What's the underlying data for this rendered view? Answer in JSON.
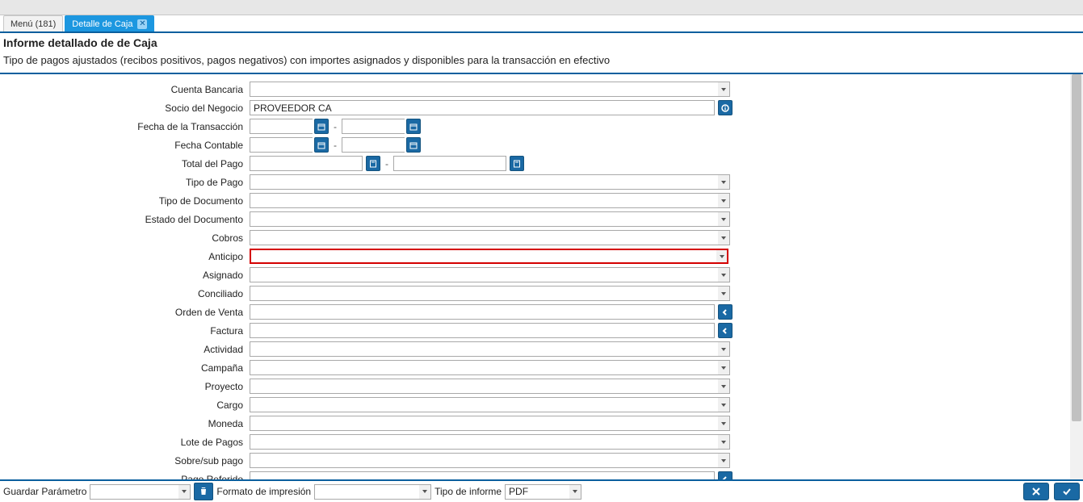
{
  "tabs": {
    "menu": "Menú (181)",
    "active": "Detalle de Caja"
  },
  "header": {
    "title": "Informe detallado de de Caja",
    "desc": "Tipo de pagos ajustados (recibos positivos, pagos negativos) con importes asignados y disponibles para la transacción en efectivo"
  },
  "labels": {
    "cuenta_bancaria": "Cuenta Bancaria",
    "socio_negocio": "Socio del Negocio",
    "fecha_transaccion": "Fecha de la Transacción",
    "fecha_contable": "Fecha Contable",
    "total_pago": "Total del Pago",
    "tipo_pago": "Tipo de Pago",
    "tipo_documento": "Tipo de Documento",
    "estado_documento": "Estado del Documento",
    "cobros": "Cobros",
    "anticipo": "Anticipo",
    "asignado": "Asignado",
    "conciliado": "Conciliado",
    "orden_venta": "Orden de Venta",
    "factura": "Factura",
    "actividad": "Actividad",
    "campana": "Campaña",
    "proyecto": "Proyecto",
    "cargo": "Cargo",
    "moneda": "Moneda",
    "lote_pagos": "Lote de Pagos",
    "sobre_sub_pago": "Sobre/sub pago",
    "pago_referido": "Pago Referido"
  },
  "values": {
    "socio_negocio": "PROVEEDOR CA"
  },
  "footer": {
    "guardar_parametro": "Guardar Parámetro",
    "formato_impresion": "Formato de impresión",
    "tipo_informe": "Tipo de informe",
    "tipo_informe_value": "PDF"
  }
}
